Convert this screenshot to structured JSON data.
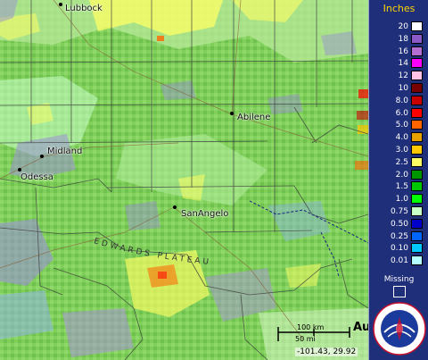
{
  "map": {
    "cities": [
      {
        "name": "Lubbock"
      },
      {
        "name": "Abilene"
      },
      {
        "name": "Midland"
      },
      {
        "name": "Odessa"
      },
      {
        "name": "SanAngelo"
      }
    ],
    "region_label": "EDWARDS PLATEAU",
    "scale": {
      "km": "100 km",
      "mi": "50 mi"
    },
    "coordinates": "-101.43, 29.92",
    "edge_text": "Au"
  },
  "legend": {
    "title": "Inches",
    "title_color": "#ffd400",
    "background": "#1f2f7a",
    "entries": [
      {
        "value": "20",
        "color": "#ffffff"
      },
      {
        "value": "18",
        "color": "#8c5ac8"
      },
      {
        "value": "16",
        "color": "#b46ed2"
      },
      {
        "value": "14",
        "color": "#ff00ff"
      },
      {
        "value": "12",
        "color": "#ffc3e6"
      },
      {
        "value": "10",
        "color": "#780000"
      },
      {
        "value": "8.0",
        "color": "#c80000"
      },
      {
        "value": "6.0",
        "color": "#ff0000"
      },
      {
        "value": "5.0",
        "color": "#ff6400"
      },
      {
        "value": "4.0",
        "color": "#e6a000"
      },
      {
        "value": "3.0",
        "color": "#ffc800"
      },
      {
        "value": "2.5",
        "color": "#ffff64"
      },
      {
        "value": "2.0",
        "color": "#009600"
      },
      {
        "value": "1.5",
        "color": "#00c800"
      },
      {
        "value": "1.0",
        "color": "#00ff00"
      },
      {
        "value": "0.75",
        "color": "#c8ffc8"
      },
      {
        "value": "0.50",
        "color": "#0000c8"
      },
      {
        "value": "0.25",
        "color": "#0064ff"
      },
      {
        "value": "0.10",
        "color": "#00c8ff"
      },
      {
        "value": "0.01",
        "color": "#b4ffff"
      }
    ],
    "missing_label": "Missing"
  },
  "logo": {
    "icon": "nws-logo",
    "text": "NATIONAL WEATHER SERVICE"
  }
}
